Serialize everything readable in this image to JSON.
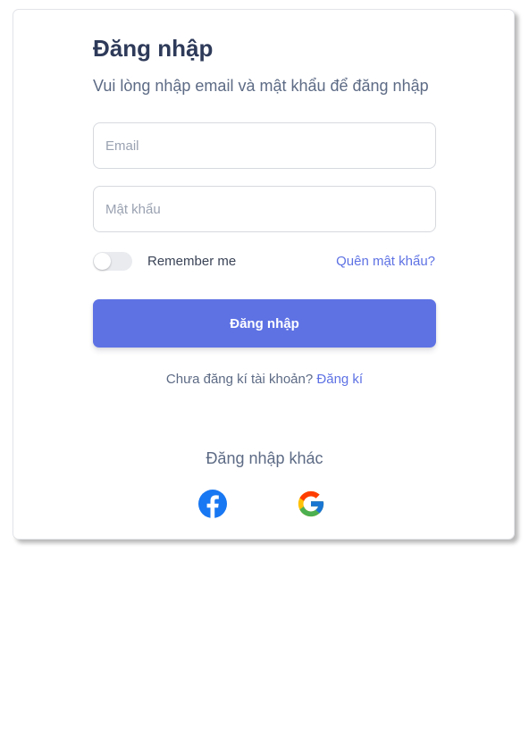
{
  "login": {
    "title": "Đăng nhập",
    "subtitle": "Vui lòng nhập email và mật khẩu để đăng nhập",
    "email_placeholder": "Email",
    "email_value": "",
    "password_placeholder": "Mật khẩu",
    "password_value": "",
    "remember_label": "Remember me",
    "remember_checked": false,
    "forgot_label": "Quên mật khẩu?",
    "submit_label": "Đăng nhập",
    "signup_prompt": "Chưa đăng kí tài khoản?",
    "signup_link": "Đăng kí"
  },
  "social": {
    "title": "Đăng nhập khác",
    "providers": [
      {
        "icon": "facebook-icon"
      },
      {
        "icon": "google-icon"
      }
    ]
  },
  "colors": {
    "accent": "#5e72e4",
    "heading": "#2e3a59",
    "muted": "#5d6b85",
    "facebook": "#1877f2"
  }
}
